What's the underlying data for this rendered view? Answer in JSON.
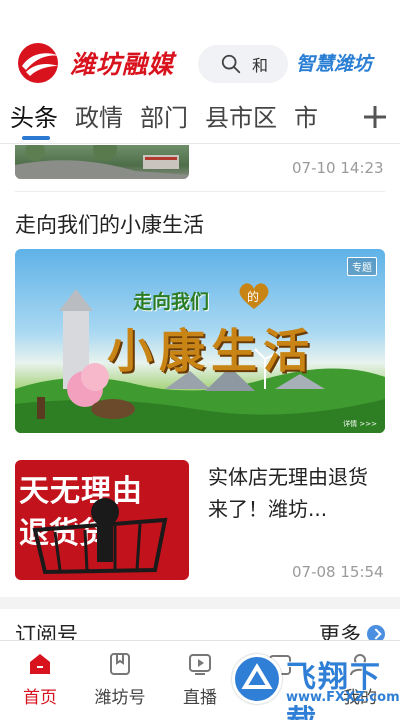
{
  "header": {
    "logo_text": "潍坊融媒",
    "search_placeholder": "和",
    "brand_right": "智慧潍坊",
    "colors": {
      "brand_red": "#d8131e",
      "accent_blue": "#2a78d2"
    }
  },
  "tabs": {
    "items": [
      "头条",
      "政情",
      "部门",
      "县市区",
      "市"
    ],
    "active_index": 0,
    "add_icon": "plus-icon"
  },
  "feed": {
    "top_item_time": "07-10 14:23",
    "article1": {
      "title": "走向我们的小康生活",
      "banner_tag": "专题",
      "banner_line1": "走向我们",
      "banner_heart_text": "的",
      "banner_line2": "小康生活",
      "banner_detail": "详情 >>>"
    },
    "article2": {
      "title": "实体店无理由退货来了！潍坊...",
      "image_text1": "天无理由",
      "image_text2": "退货货",
      "time": "07-08 15:54"
    },
    "subscribe": {
      "title": "订阅号",
      "more": "更多"
    }
  },
  "bottom_nav": {
    "items": [
      {
        "label": "首页",
        "icon": "home-icon"
      },
      {
        "label": "潍坊号",
        "icon": "bookmark-icon"
      },
      {
        "label": "直播",
        "icon": "play-icon"
      },
      {
        "label": "",
        "icon": "calendar-icon"
      },
      {
        "label": "我的",
        "icon": "user-icon"
      }
    ],
    "active_index": 0
  },
  "watermark": {
    "big": "飞翔下载",
    "small": "www.FXXZ.com"
  }
}
